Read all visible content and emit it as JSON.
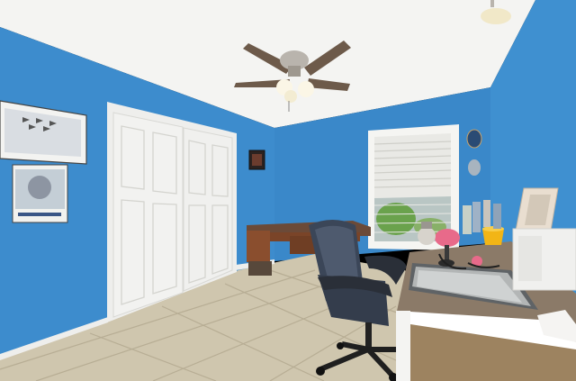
{
  "scene": {
    "kind": "photo",
    "description_hidden": true
  },
  "colors": {
    "wall_blue": "#3d8ccd",
    "wall_blue_dark": "#2f78b8",
    "ceiling": "#f4f4f2",
    "floor_tile": "#cfc6ae",
    "floor_grout": "#b7ad94",
    "door_white": "#f2f2f0",
    "trim_white": "#eeeeec",
    "desk_wood": "#8a4e2e",
    "desk_top": "#6b4a38",
    "chair_leather": "#3b4658",
    "fan_blade": "#6d5a4a",
    "fan_metal": "#b9b4ad",
    "window_blind": "#e9e9e5",
    "foliage": "#6aa24c",
    "lamp_pink": "#e86a8a",
    "mug_yellow": "#f2b516",
    "printer_white": "#f0f0ee"
  },
  "icons": [
    "ceiling-fan-icon",
    "office-chair-icon",
    "printer-icon",
    "desk-lamp-icon"
  ]
}
